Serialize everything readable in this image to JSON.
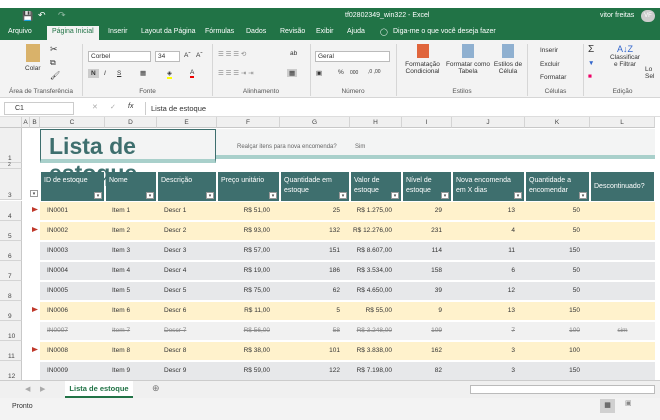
{
  "window": {
    "title": "tf02802349_win322 - Excel",
    "user": "vitor freitas",
    "avatar": "VF"
  },
  "colors": {
    "accent": "#217346",
    "header": "#3e6f6e",
    "highlight": "#fff2cc",
    "row": "#e7e8ea"
  },
  "tabs": [
    "Arquivo",
    "Página Inicial",
    "Inserir",
    "Layout da Página",
    "Fórmulas",
    "Dados",
    "Revisão",
    "Exibir",
    "Ajuda"
  ],
  "tell_me": "Diga-me o que você deseja fazer",
  "ribbon": {
    "clipboard": {
      "paste": "Colar",
      "group": "Área de Transferência"
    },
    "font": {
      "name": "Corbel",
      "size": "34",
      "bold": "N",
      "italic": "I",
      "underline": "S",
      "group": "Fonte"
    },
    "alignment": {
      "group": "Alinhamento"
    },
    "number": {
      "format": "Geral",
      "percent": "%",
      "thousands": "000",
      "group": "Número"
    },
    "styles": {
      "conditional": "Formatação Condicional",
      "table": "Formatar como Tabela",
      "cell": "Estilos de Célula",
      "group": "Estilos"
    },
    "cells": {
      "insert": "Inserir",
      "delete": "Excluir",
      "format": "Formatar",
      "group": "Células"
    },
    "editing": {
      "sort": "Classificar e Filtrar",
      "find": "Lo Sel",
      "group": "Edição"
    }
  },
  "formula_bar": {
    "name_box": "C1",
    "fx": "fx",
    "value": "Lista de estoque"
  },
  "columns": [
    "A",
    "B",
    "C",
    "D",
    "E",
    "F",
    "G",
    "H",
    "I",
    "J",
    "K",
    "L"
  ],
  "sheet": {
    "title": "Lista de estoque",
    "highlight_label": "Realçar itens para nova encomenda?",
    "highlight_value": "Sim",
    "headers": [
      "ID de estoque",
      "Nome",
      "Descrição",
      "Preço unitário",
      "Quantidade em estoque",
      "Valor de estoque",
      "Nível de estoque",
      "Nova encomenda em X dias",
      "Quantidade a encomendar",
      "Descontinuado?"
    ],
    "rows": [
      {
        "n": "4",
        "flag": true,
        "type": "hl",
        "v": [
          "IN0001",
          "Item 1",
          "Descr 1",
          "R$ 51,00",
          "25",
          "R$ 1.275,00",
          "29",
          "13",
          "50",
          ""
        ]
      },
      {
        "n": "5",
        "flag": true,
        "type": "hl",
        "v": [
          "IN0002",
          "Item 2",
          "Descr 2",
          "R$ 93,00",
          "132",
          "R$ 12.276,00",
          "231",
          "4",
          "50",
          ""
        ]
      },
      {
        "n": "6",
        "flag": false,
        "type": "n",
        "v": [
          "IN0003",
          "Item 3",
          "Descr 3",
          "R$ 57,00",
          "151",
          "R$ 8.607,00",
          "114",
          "11",
          "150",
          ""
        ]
      },
      {
        "n": "7",
        "flag": false,
        "type": "n",
        "v": [
          "IN0004",
          "Item 4",
          "Descr 4",
          "R$ 19,00",
          "186",
          "R$ 3.534,00",
          "158",
          "6",
          "50",
          ""
        ]
      },
      {
        "n": "8",
        "flag": false,
        "type": "n",
        "v": [
          "IN0005",
          "Item 5",
          "Descr 5",
          "R$ 75,00",
          "62",
          "R$ 4.650,00",
          "39",
          "12",
          "50",
          ""
        ]
      },
      {
        "n": "9",
        "flag": true,
        "type": "hl",
        "v": [
          "IN0006",
          "Item 6",
          "Descr 6",
          "R$ 11,00",
          "5",
          "R$ 55,00",
          "9",
          "13",
          "150",
          ""
        ]
      },
      {
        "n": "10",
        "flag": false,
        "type": "strike",
        "v": [
          "IN0007",
          "Item 7",
          "Descr 7",
          "R$ 56,00",
          "58",
          "R$ 3.248,00",
          "109",
          "7",
          "100",
          "sim"
        ]
      },
      {
        "n": "11",
        "flag": true,
        "type": "hl",
        "v": [
          "IN0008",
          "Item 8",
          "Descr 8",
          "R$ 38,00",
          "101",
          "R$ 3.838,00",
          "162",
          "3",
          "100",
          ""
        ]
      },
      {
        "n": "12",
        "flag": false,
        "type": "n",
        "v": [
          "IN0009",
          "Item 9",
          "Descr 9",
          "R$ 59,00",
          "122",
          "R$ 7.198,00",
          "82",
          "3",
          "150",
          ""
        ]
      }
    ]
  },
  "sheet_tab": "Lista de estoque",
  "status": "Pronto"
}
